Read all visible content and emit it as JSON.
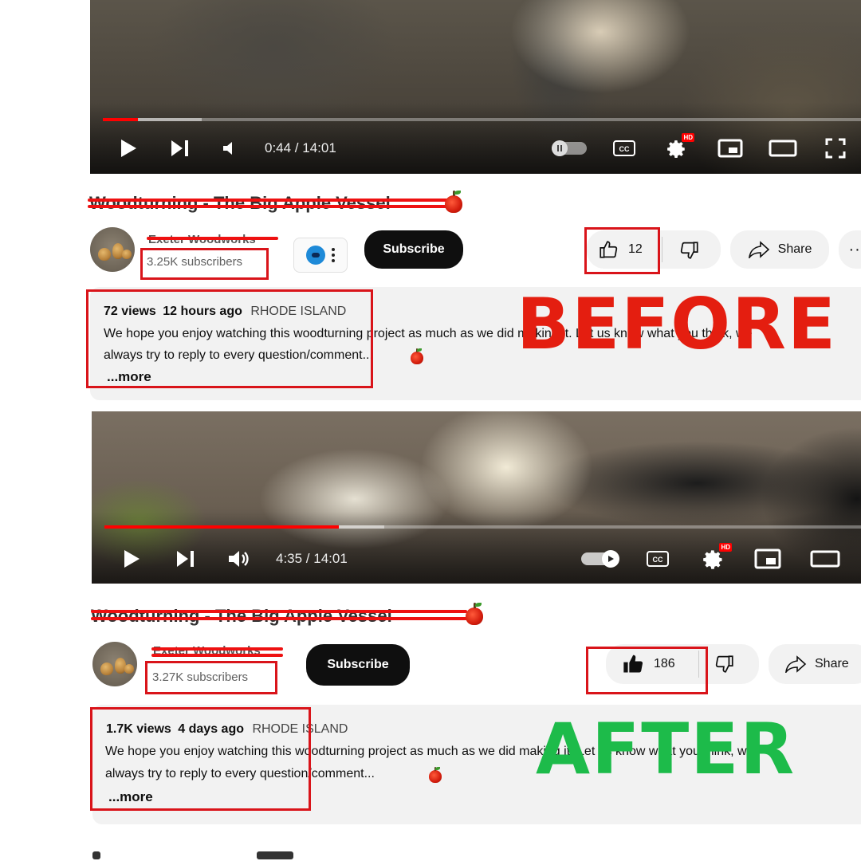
{
  "before": {
    "player": {
      "time": "0:44 / 14:01",
      "progress": 0.046
    },
    "title": "Woodturning - The Big Apple Vessel",
    "channel": {
      "name": "Exeter Woodworks",
      "subscribers": "3.25K subscribers",
      "subscribe_label": "Subscribe"
    },
    "actions": {
      "likes": "12",
      "share_label": "Share"
    },
    "description": {
      "views": "72 views",
      "age": "12 hours ago",
      "location": "RHODE ISLAND",
      "line1": "We hope you enjoy watching this woodturning project as much as we did making it. Let us know what you think, we",
      "line2": "always try to reply to every question/comment...",
      "more": "...more"
    },
    "stamp": "BEFORE"
  },
  "after": {
    "player": {
      "time": "4:35 / 14:01",
      "progress": 0.31
    },
    "title": "Woodturning - The Big Apple Vessel",
    "channel": {
      "name": "Exeter Woodworks",
      "subscribers": "3.27K subscribers",
      "subscribe_label": "Subscribe"
    },
    "actions": {
      "likes": "186",
      "share_label": "Share"
    },
    "description": {
      "views": "1.7K views",
      "age": "4 days ago",
      "location": "RHODE ISLAND",
      "line1": "We hope you enjoy watching this woodturning project as much as we did making it. Let us know what you think, we",
      "line2": "always try to reply to every question/comment...",
      "more": "...more"
    },
    "stamp": "AFTER"
  },
  "colors": {
    "annotation_red": "#d9141a",
    "before_stamp": "#e41e10",
    "after_stamp": "#1dbb4a",
    "progress_red": "#ff0000"
  }
}
